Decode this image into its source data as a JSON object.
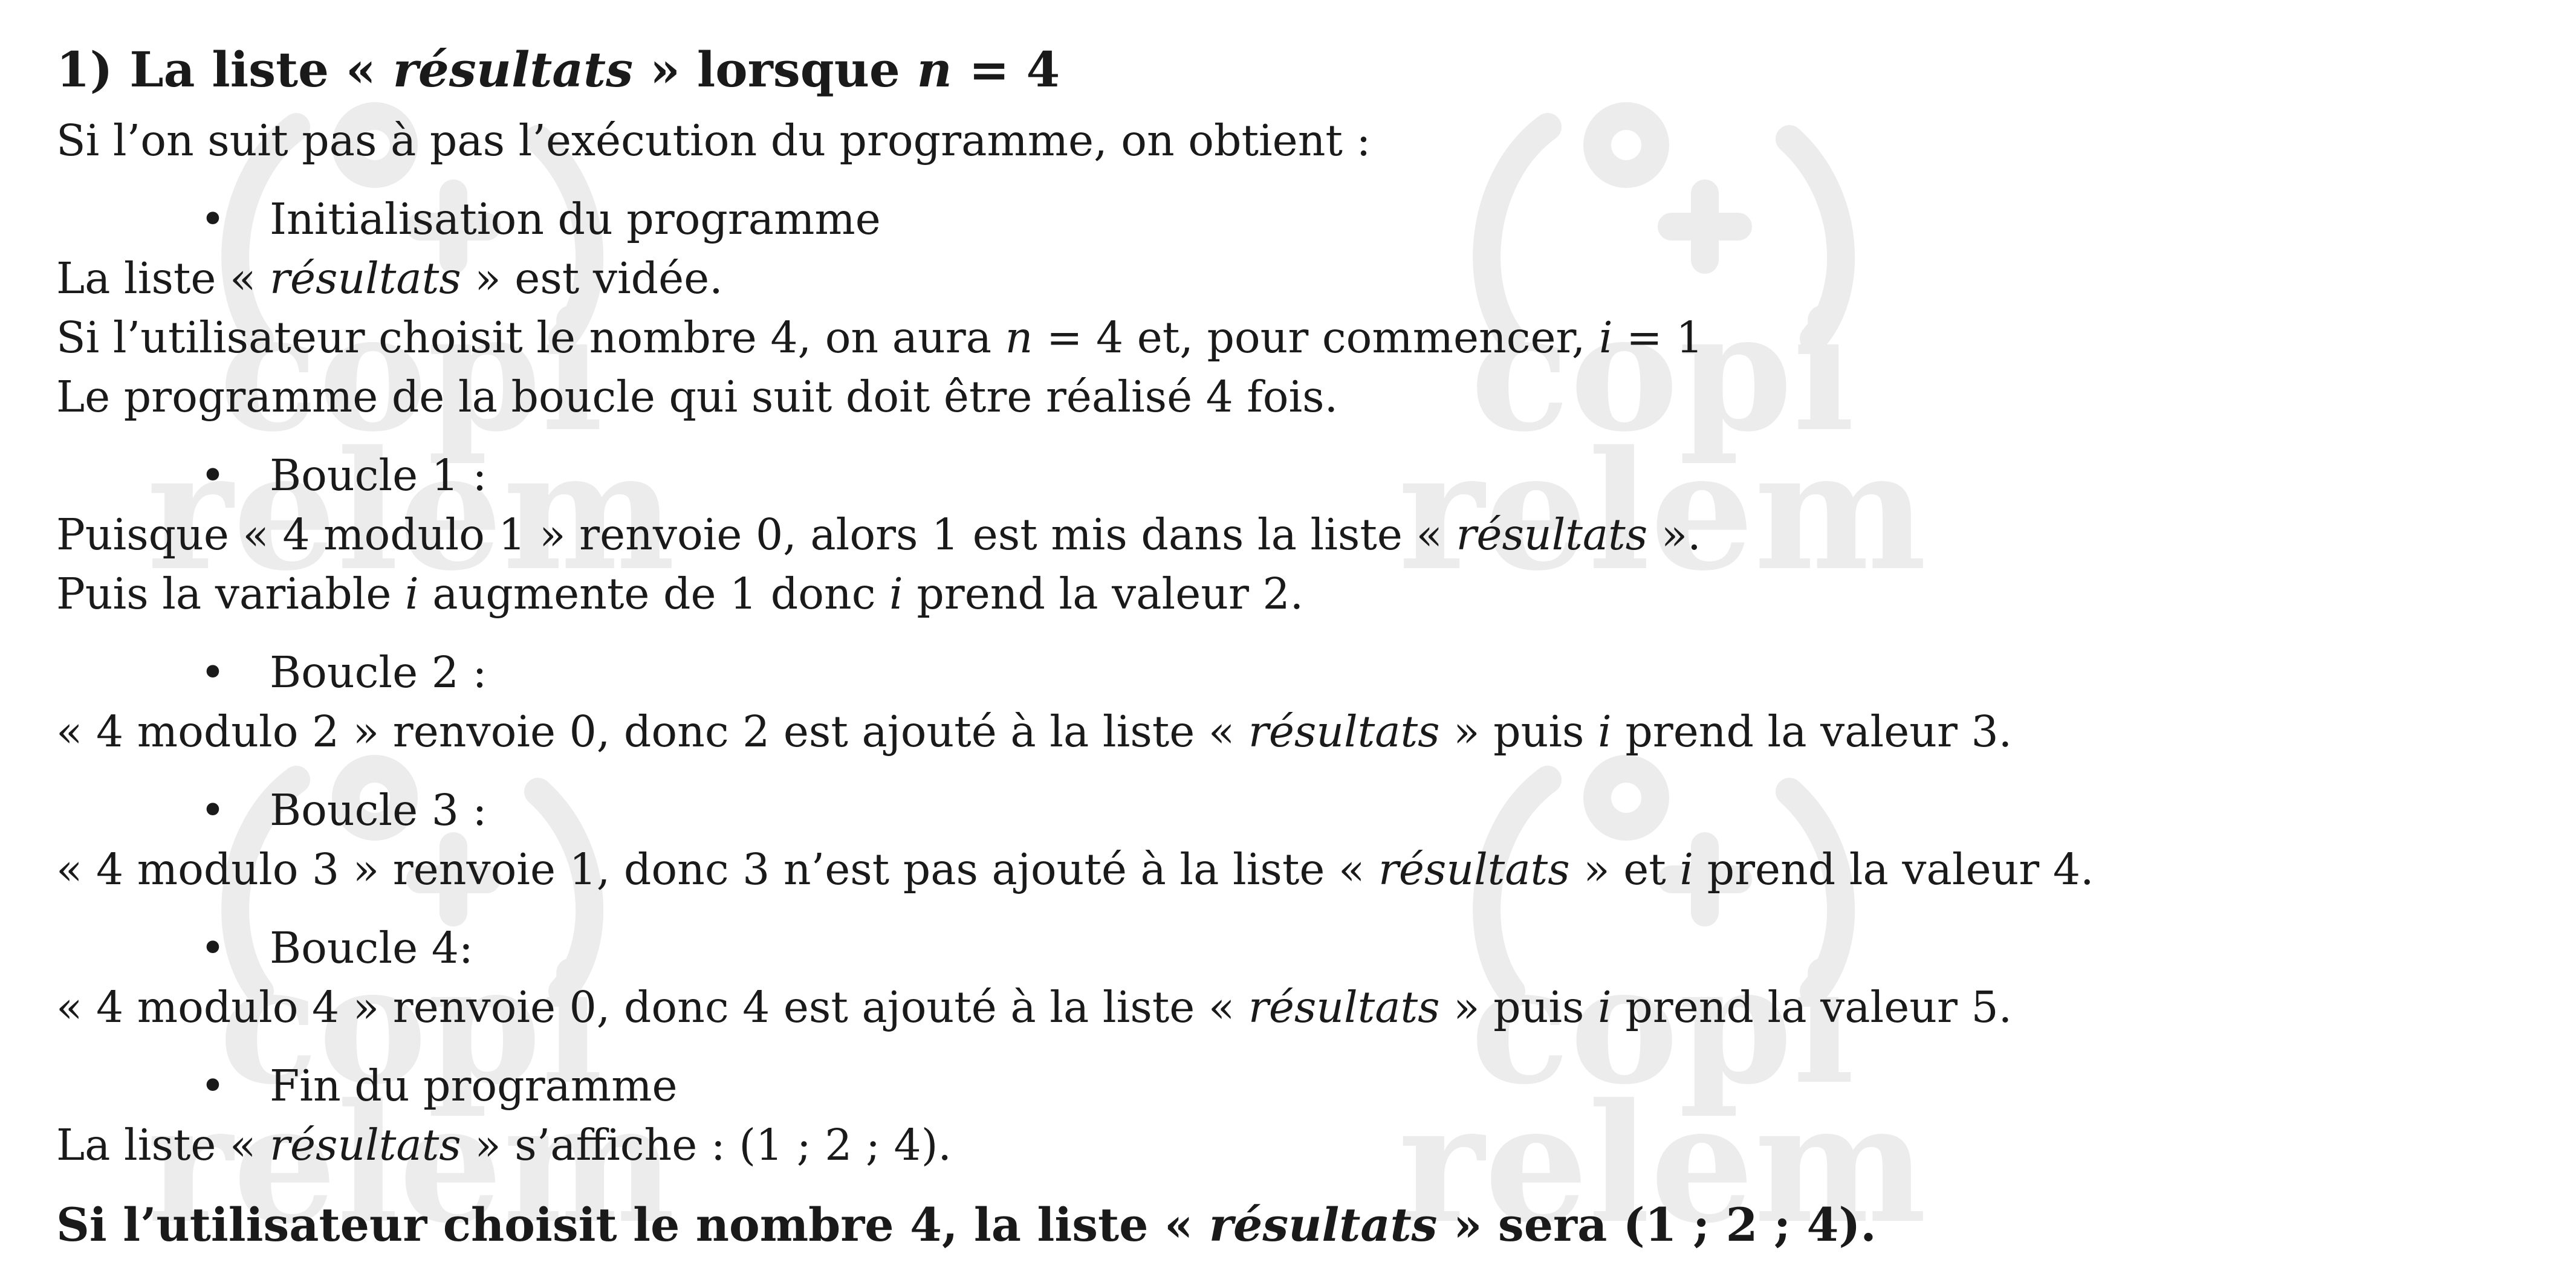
{
  "title": {
    "num": "1)",
    "pre": "La liste «",
    "em": "résultats",
    "mid": "» lorsque",
    "var": "n",
    "post": "= 4"
  },
  "intro": "Si l’on suit pas à pas l’exécution du programme, on obtient :",
  "bullet_symbol": "•",
  "init": {
    "label": "Initialisation du programme",
    "l1_pre": "La liste «",
    "l1_em": "résultats",
    "l1_post": "» est vidée.",
    "l2_a": "Si l’utilisateur choisit le nombre 4, on aura",
    "l2_n": "n",
    "l2_b": "= 4 et, pour commencer,",
    "l2_i": "i",
    "l2_c": "= 1",
    "l3": "Le programme de la boucle qui suit doit être réalisé 4 fois."
  },
  "loop1": {
    "label": "Boucle 1 :",
    "l1_pre": "Puisque « 4 modulo 1 » renvoie 0, alors 1 est mis dans la liste «",
    "l1_em": "résultats",
    "l1_post": "».",
    "l2_a": "Puis la variable",
    "l2_i": "i",
    "l2_b": "augmente de 1 donc",
    "l2_i2": "i",
    "l2_c": "prend la valeur 2."
  },
  "loop2": {
    "label": "Boucle 2 :",
    "l1_pre": "« 4 modulo 2 » renvoie 0, donc 2 est ajouté à la liste «",
    "l1_em": "résultats",
    "l1_mid": "» puis",
    "l1_i": "i",
    "l1_post": "prend la valeur 3."
  },
  "loop3": {
    "label": "Boucle 3 :",
    "l1_pre": "« 4 modulo 3 » renvoie 1, donc 3 n’est pas ajouté à la liste «",
    "l1_em": "résultats",
    "l1_mid": "» et",
    "l1_i": "i",
    "l1_post": "prend la valeur 4."
  },
  "loop4": {
    "label": "Boucle 4:",
    "l1_pre": " « 4 modulo 4 » renvoie 0, donc 4 est ajouté à la liste «",
    "l1_em": "résultats",
    "l1_mid": "» puis",
    "l1_i": "i",
    "l1_post": "prend la valeur 5."
  },
  "end": {
    "label": "Fin du programme",
    "l1_pre": "La liste «",
    "l1_em": "résultats",
    "l1_post": "» s’affiche : (1 ; 2 ; 4)."
  },
  "conclusion": {
    "pre": "Si l’utilisateur choisit le nombre 4, la liste «",
    "em": "résultats",
    "post": "» sera (1 ; 2 ; 4)."
  },
  "watermark": {
    "word1": "copi",
    "word2": "relem",
    "color": "#ededed"
  }
}
